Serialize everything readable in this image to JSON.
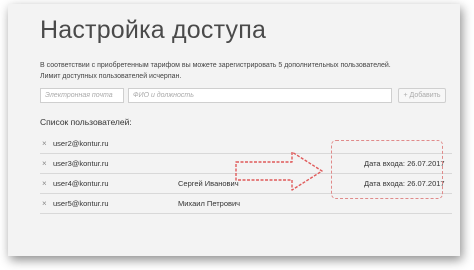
{
  "page": {
    "title": "Настройка доступа",
    "notice_line1": "В соответствии с приобретенным тарифом вы можете зарегистрировать 5 дополнительных пользователей.",
    "notice_line2": "Лимит доступных пользователей исчерпан."
  },
  "form": {
    "email_placeholder": "Электронная почта",
    "fio_placeholder": "ФИО и должность",
    "add_button": "+ Добавить"
  },
  "users": {
    "header": "Список пользователей:",
    "rows": [
      {
        "email": "user2@kontur.ru",
        "fio": "",
        "login": ""
      },
      {
        "email": "user3@kontur.ru",
        "fio": "",
        "login": "Дата входа: 26.07.2017"
      },
      {
        "email": "user4@kontur.ru",
        "fio": "Сергей Иванович",
        "login": "Дата входа: 26.07.2017"
      },
      {
        "email": "user5@kontur.ru",
        "fio": "Михаил Петрович",
        "login": ""
      }
    ]
  },
  "icons": {
    "remove": "×",
    "remove_icon_name": "close-icon"
  },
  "colors": {
    "annotation": "#e05a5a",
    "frame_bg": "#f3f3f3"
  }
}
